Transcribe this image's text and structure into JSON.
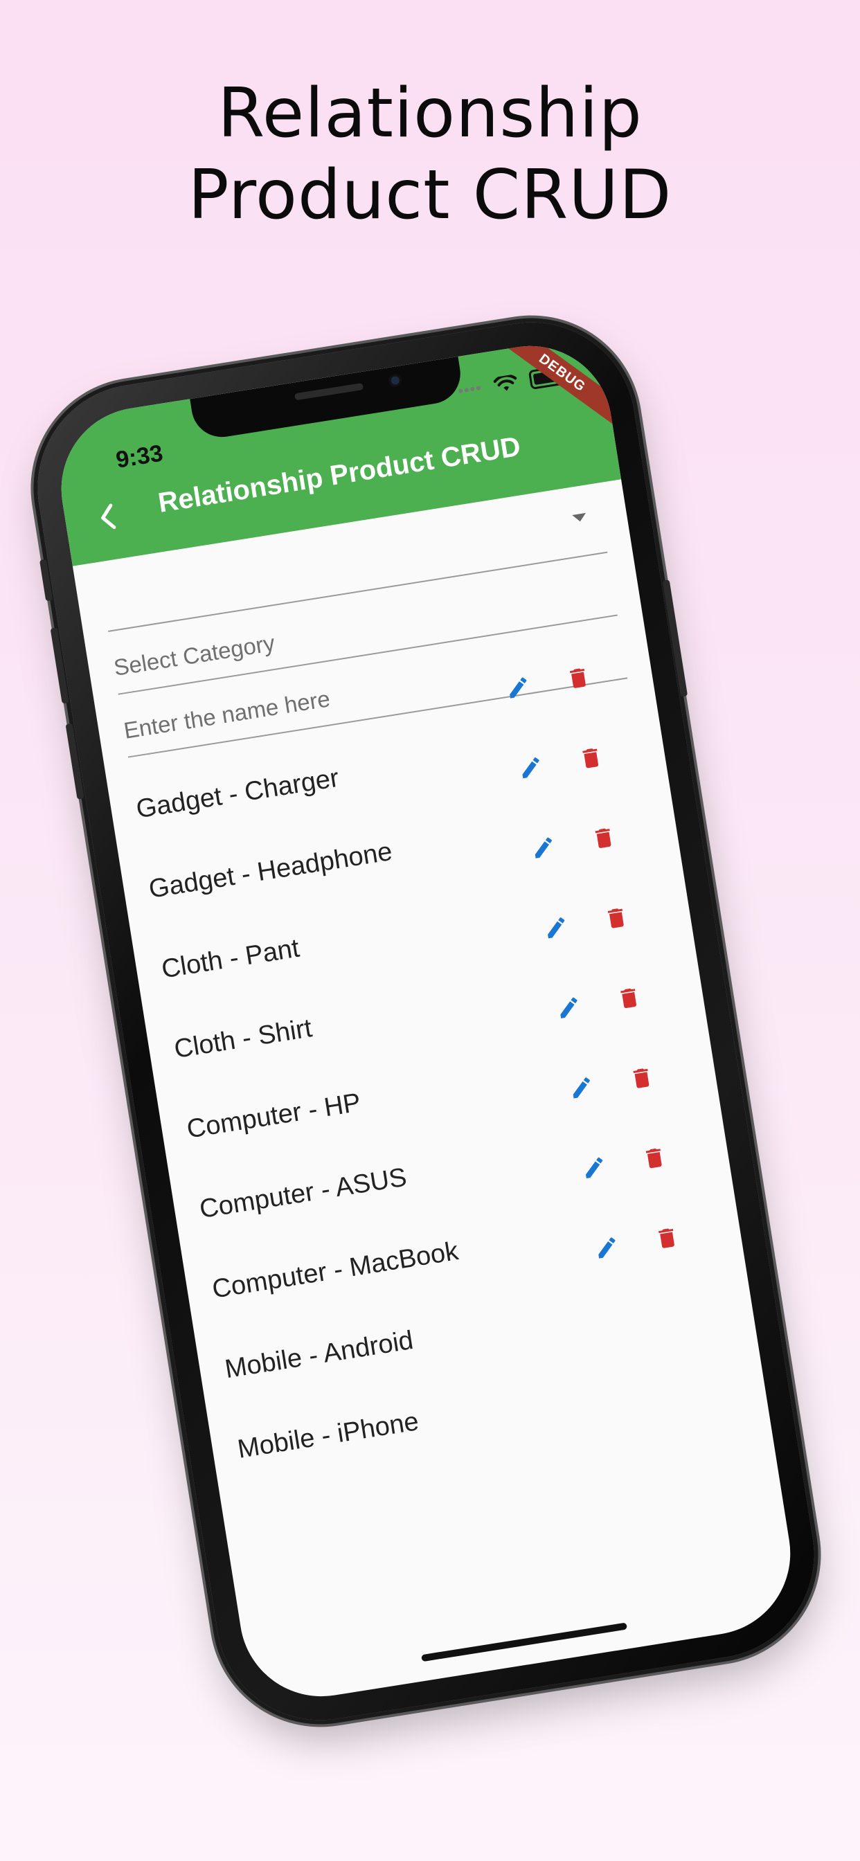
{
  "headline": {
    "line1": "Relationship",
    "line2": "Product CRUD"
  },
  "status_bar": {
    "time": "9:33",
    "debug_banner": "DEBUG"
  },
  "appbar": {
    "title": "Relationship Product CRUD",
    "back_icon": "chevron-left-icon",
    "color": "#4caf50"
  },
  "form": {
    "category_dropdown": {
      "placeholder": "Select Category",
      "icon": "dropdown-arrow-icon"
    },
    "name_field": {
      "placeholder": "Enter the name here",
      "value": ""
    }
  },
  "products": [
    {
      "label": "Gadget - Charger"
    },
    {
      "label": "Gadget - Headphone"
    },
    {
      "label": "Cloth - Pant"
    },
    {
      "label": "Cloth - Shirt"
    },
    {
      "label": "Computer - HP"
    },
    {
      "label": "Computer - ASUS"
    },
    {
      "label": "Computer - MacBook"
    },
    {
      "label": "Mobile - Android"
    },
    {
      "label": "Mobile - iPhone"
    }
  ],
  "row_actions": {
    "edit_icon": "pencil-icon",
    "delete_icon": "trash-icon",
    "edit_color": "#1976d2",
    "delete_color": "#d32f2f"
  }
}
